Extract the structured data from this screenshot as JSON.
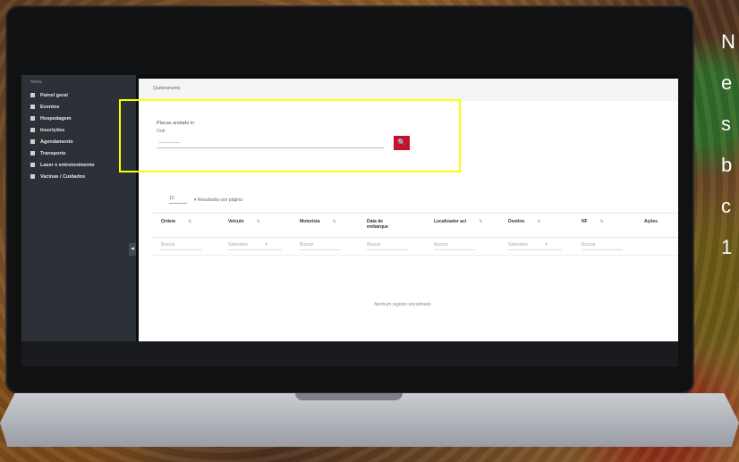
{
  "sidebar": {
    "header": "menu",
    "items": [
      {
        "label": "Painel geral",
        "icon": "dashboard-icon"
      },
      {
        "label": "Eventos",
        "icon": "calendar-icon"
      },
      {
        "label": "Hospedagem",
        "icon": "building-icon"
      },
      {
        "label": "Inscrições",
        "icon": "users-icon"
      },
      {
        "label": "Agendamento",
        "icon": "clock-icon"
      },
      {
        "label": "Transporte",
        "icon": "bus-icon"
      },
      {
        "label": "Laser e entretenimento",
        "icon": "star-icon"
      },
      {
        "label": "Vacinas / Cuidados",
        "icon": "syringe-icon"
      }
    ],
    "collapse_symbol": "◂"
  },
  "breadcrumb": "Quebramento",
  "search": {
    "label": "Placas andado in",
    "sublabel": "Ordi",
    "placeholder": "---------------",
    "button_symbol": "🔍"
  },
  "paging": {
    "per_page": "10",
    "text": "▾  Resultados por página"
  },
  "table": {
    "columns": [
      "Ordem",
      "Veículo",
      "Motorista",
      "Data de embarque",
      "Localizador aci",
      "Destino",
      "NF",
      "Ações"
    ],
    "filters": [
      "Buscar",
      "Selecione",
      "Buscar",
      "Buscar",
      "Buscar",
      "Selecione",
      "Buscar"
    ],
    "empty_message": "Nenhum registro encontrado"
  },
  "side_text_lines": [
    "N",
    "e",
    "s",
    "b",
    "c",
    "1"
  ],
  "colors": {
    "accent": "#c8102e",
    "highlight": "#ffff00",
    "sidebar": "#2c3138"
  }
}
